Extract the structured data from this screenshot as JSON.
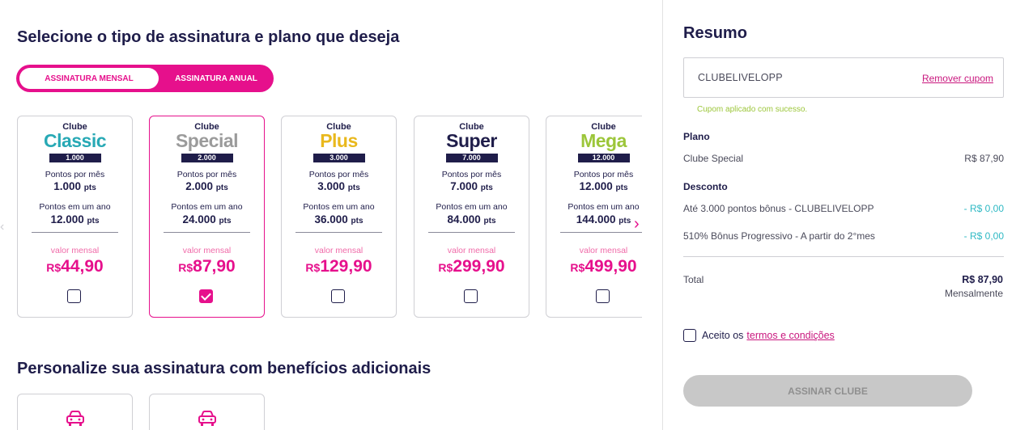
{
  "main": {
    "title": "Selecione o tipo de assinatura e plano que deseja",
    "toggle": {
      "monthly": "ASSINATURA MENSAL",
      "annual": "ASSINATURA ANUAL",
      "selected": "monthly"
    },
    "plans": [
      {
        "club": "Clube",
        "name": "Classic",
        "badge": "1.000",
        "name_color": "#28a9b5",
        "per_month_label": "Pontos por mês",
        "per_month": "1.000",
        "per_year_label": "Pontos em um ano",
        "per_year": "12.000",
        "unit": "pts",
        "price_label": "valor mensal",
        "currency": "R$",
        "price": "44,90",
        "selected": false
      },
      {
        "club": "Clube",
        "name": "Special",
        "badge": "2.000",
        "name_color": "#9b9b9b",
        "per_month_label": "Pontos por mês",
        "per_month": "2.000",
        "per_year_label": "Pontos em um ano",
        "per_year": "24.000",
        "unit": "pts",
        "price_label": "valor mensal",
        "currency": "R$",
        "price": "87,90",
        "selected": true
      },
      {
        "club": "Clube",
        "name": "Plus",
        "badge": "3.000",
        "name_color": "#e9b81c",
        "per_month_label": "Pontos por mês",
        "per_month": "3.000",
        "per_year_label": "Pontos em um ano",
        "per_year": "36.000",
        "unit": "pts",
        "price_label": "valor mensal",
        "currency": "R$",
        "price": "129,90",
        "selected": false
      },
      {
        "club": "Clube",
        "name": "Super",
        "badge": "7.000",
        "name_color": "#1f1d4a",
        "per_month_label": "Pontos por mês",
        "per_month": "7.000",
        "per_year_label": "Pontos em um ano",
        "per_year": "84.000",
        "unit": "pts",
        "price_label": "valor mensal",
        "currency": "R$",
        "price": "299,90",
        "selected": false
      },
      {
        "club": "Clube",
        "name": "Mega",
        "badge": "12.000",
        "name_color": "#9cc63a",
        "per_month_label": "Pontos por mês",
        "per_month": "12.000",
        "per_year_label": "Pontos em um ano",
        "per_year": "144.000",
        "unit": "pts",
        "price_label": "valor mensal",
        "currency": "R$",
        "price": "499,90",
        "selected": false
      }
    ],
    "benefits_title": "Personalize sua assinatura com benefícios adicionais",
    "next_arrow": "›",
    "prev_arrow": "‹"
  },
  "summary": {
    "title": "Resumo",
    "coupon_code": "CLUBELIVELOPP",
    "remove_coupon": "Remover cupom",
    "coupon_success": "Cupom aplicado com sucesso.",
    "plan_heading": "Plano",
    "plan_name": "Clube Special",
    "plan_price": "R$ 87,90",
    "discount_heading": "Desconto",
    "discounts": [
      {
        "label": "Até 3.000 pontos bônus - CLUBELIVELOPP",
        "value": "- R$ 0,00"
      },
      {
        "label": "510% Bônus Progressivo - A partir do 2°mes",
        "value": "- R$ 0,00"
      }
    ],
    "total_label": "Total",
    "total_value": "R$ 87,90",
    "total_period": "Mensalmente",
    "terms_prefix": "Aceito os",
    "terms_link": "termos e condições",
    "submit_label": "ASSINAR CLUBE"
  },
  "colors": {
    "brand": "#e6108c",
    "navy": "#1f1d4a",
    "success": "#9cc63a",
    "discount": "#2fb9c4"
  }
}
